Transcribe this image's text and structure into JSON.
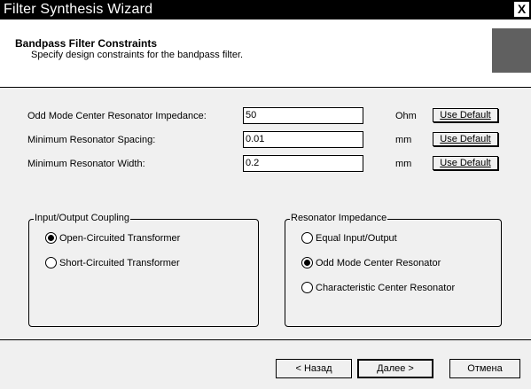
{
  "window": {
    "title": "Filter Synthesis Wizard",
    "close_label": "X"
  },
  "header": {
    "title": "Bandpass Filter Constraints",
    "subtitle": "Specify design constraints for the bandpass filter."
  },
  "fields": [
    {
      "label": "Odd Mode Center Resonator Impedance:",
      "value": "50",
      "unit": "Ohm",
      "button": "Use Default"
    },
    {
      "label": "Minimum Resonator Spacing:",
      "value": "0.01",
      "unit": "mm",
      "button": "Use Default"
    },
    {
      "label": "Minimum Resonator Width:",
      "value": "0.2",
      "unit": "mm",
      "button": "Use Default"
    }
  ],
  "coupling": {
    "label": "Input/Output Coupling",
    "options": [
      {
        "label": "Open-Circuited Transformer",
        "checked": true
      },
      {
        "label": "Short-Circuited Transformer",
        "checked": false
      }
    ]
  },
  "impedance": {
    "label": "Resonator Impedance",
    "options": [
      {
        "label": "Equal Input/Output",
        "checked": false
      },
      {
        "label": "Odd Mode Center Resonator",
        "checked": true
      },
      {
        "label": "Characteristic Center Resonator",
        "checked": false
      }
    ]
  },
  "footer": {
    "back": "< Назад",
    "next": "Далее >",
    "cancel": "Отмена"
  }
}
